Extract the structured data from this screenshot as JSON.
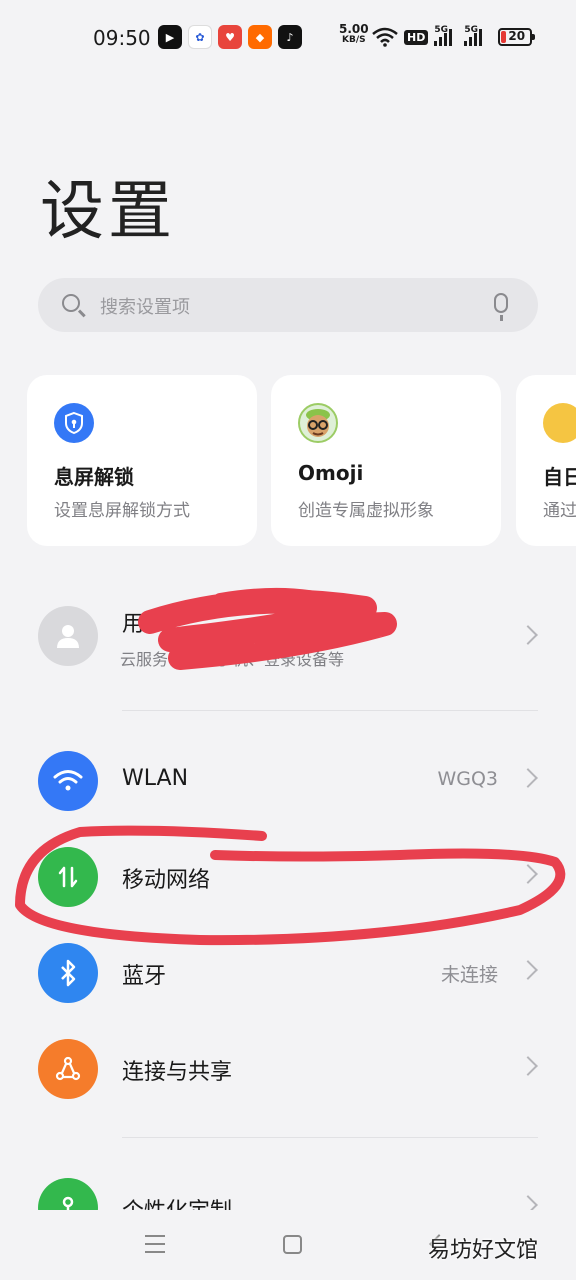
{
  "status_bar": {
    "time": "09:50",
    "net_speed": "5.00",
    "net_speed_unit": "KB/S",
    "hd": "HD",
    "sim1": "5G",
    "sim2": "5G",
    "battery": "20",
    "battery_color": "#e53935",
    "app_icons": [
      "kuaishou-app-icon",
      "baidu-app-icon",
      "heart-app-icon",
      "taobao-app-icon",
      "douyin-app-icon"
    ]
  },
  "page": {
    "title": "设置"
  },
  "search": {
    "placeholder": "搜索设置项"
  },
  "cards": [
    {
      "title": "息屏解锁",
      "subtitle": "设置息屏解锁方式",
      "icon": "lock-shield-icon",
      "color": "#3478f6"
    },
    {
      "title": "Omoji",
      "subtitle": "创造专属虚拟形象",
      "icon": "omoji-avatar-icon"
    },
    {
      "title": "自日",
      "subtitle": "通过",
      "icon": "yellow-card-icon",
      "color": "#f5c542"
    }
  ],
  "account": {
    "label": "用户",
    "subtitle": "云服务、查找手机、登录设备等"
  },
  "settings": [
    {
      "label": "WLAN",
      "value": "WGQ3",
      "icon": "wifi-icon",
      "color": "#3478f6"
    },
    {
      "label": "移动网络",
      "value": "",
      "icon": "mobile-data-icon",
      "color": "#33b84d"
    },
    {
      "label": "蓝牙",
      "value": "未连接",
      "icon": "bluetooth-icon",
      "color": "#2f86f0"
    },
    {
      "label": "连接与共享",
      "value": "",
      "icon": "share-connect-icon",
      "color": "#f57c2b"
    },
    {
      "label": "个性化定制",
      "value": "",
      "icon": "personalize-icon",
      "color": "#33b84d"
    }
  ],
  "watermark": "易坊好文馆"
}
